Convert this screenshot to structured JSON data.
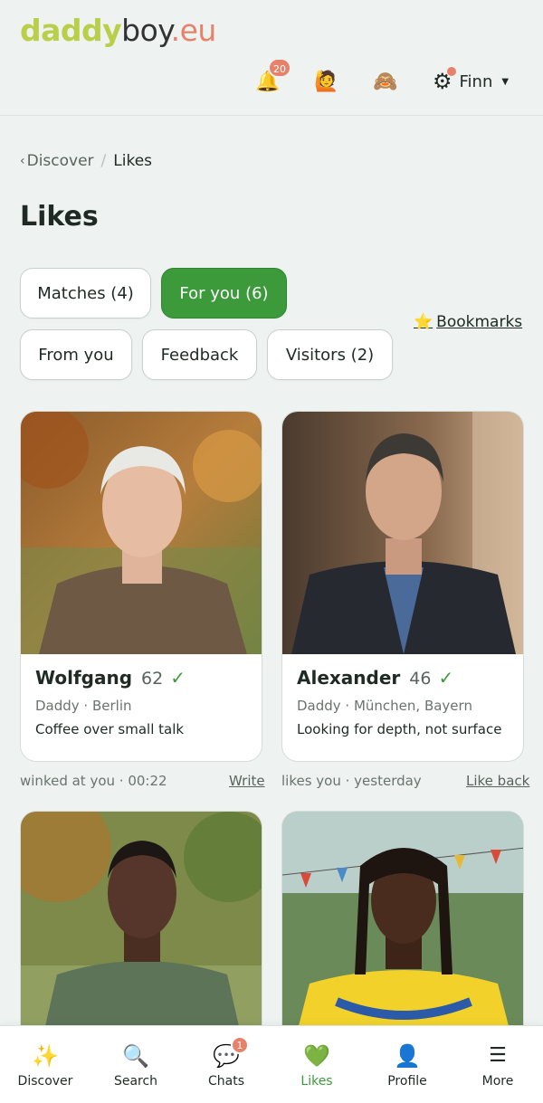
{
  "brand": {
    "part1": "daddy",
    "part2": "boy",
    "part3": ".eu"
  },
  "header": {
    "notifications_count": "20",
    "user_name": "Finn",
    "icons": [
      "bell-icon",
      "person-raising-hand-icon",
      "see-no-evil-monkey-icon",
      "gear-icon"
    ]
  },
  "breadcrumb": {
    "parent": "Discover",
    "current": "Likes"
  },
  "page": {
    "title": "Likes"
  },
  "tabs": [
    {
      "label": "Matches (4)",
      "active": false
    },
    {
      "label": "For you (6)",
      "active": true
    },
    {
      "label": "From you",
      "active": false
    },
    {
      "label": "Feedback",
      "active": false
    },
    {
      "label": "Visitors (2)",
      "active": false
    }
  ],
  "bookmarks": {
    "icon": "star-icon",
    "label": "Bookmarks"
  },
  "profiles": [
    {
      "name": "Wolfgang",
      "age": "62",
      "role": "Daddy",
      "location": "Berlin",
      "tagline": "Coffee over small talk",
      "activity": "winked at you · 00:22",
      "action": "Write"
    },
    {
      "name": "Alexander",
      "age": "46",
      "role": "Daddy",
      "location": "München, Bayern",
      "tagline": "Looking for depth, not surface",
      "activity": "likes you · yesterday",
      "action": "Like back"
    }
  ],
  "profile_meta": [
    "Daddy · Berlin",
    "Daddy · München, Bayern"
  ],
  "bottom_nav": [
    {
      "label": "Discover",
      "icon": "sparkles-icon"
    },
    {
      "label": "Search",
      "icon": "magnifier-icon"
    },
    {
      "label": "Chats",
      "icon": "speech-bubble-icon",
      "badge": "1"
    },
    {
      "label": "Likes",
      "icon": "green-heart-icon",
      "active": true
    },
    {
      "label": "Profile",
      "icon": "user-silhouette-icon"
    },
    {
      "label": "More",
      "icon": "menu-icon"
    }
  ],
  "colors": {
    "accent_green": "#3c9a3a",
    "accent_coral": "#e7826a",
    "logo_lime": "#b9cf4a",
    "background": "#eef2f0"
  }
}
